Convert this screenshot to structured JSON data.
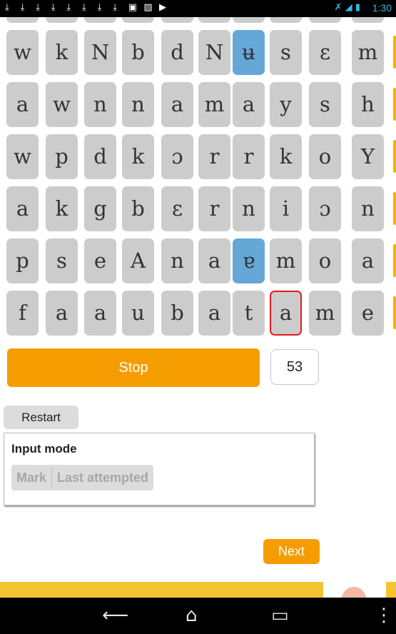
{
  "status_bar": {
    "time": "1:30",
    "notification_icons": [
      "download-icon",
      "download-icon",
      "download-icon",
      "download-icon",
      "download-icon",
      "download-icon",
      "download-icon",
      "download-icon",
      "sd-card-icon",
      "image-icon",
      "video-icon"
    ],
    "system_icons": [
      "mute-icon",
      "wifi-icon",
      "battery-icon"
    ]
  },
  "grid": {
    "rows": [
      [
        "w",
        "k",
        "N",
        "b",
        "d",
        "N",
        "ʉ",
        "s",
        "ɛ",
        "m"
      ],
      [
        "a",
        "w",
        "n",
        "n",
        "a",
        "m",
        "a",
        "y",
        "s",
        "h"
      ],
      [
        "w",
        "p",
        "d",
        "k",
        "ɔ",
        "r",
        "r",
        "k",
        "o",
        "Y"
      ],
      [
        "a",
        "k",
        "g",
        "b",
        "ɛ",
        "r",
        "n",
        "i",
        "ɔ",
        "n"
      ],
      [
        "p",
        "s",
        "e",
        "A",
        "n",
        "a",
        "ɐ",
        "m",
        "o",
        "a"
      ],
      [
        "f",
        "a",
        "a",
        "u",
        "b",
        "a",
        "t",
        "a",
        "m",
        "e"
      ]
    ],
    "marked_cells": [
      [
        0,
        6
      ],
      [
        4,
        6
      ]
    ],
    "current_cell": [
      5,
      7
    ]
  },
  "controls": {
    "stop_label": "Stop",
    "counter": "53",
    "restart_label": "Restart",
    "next_label": "Next"
  },
  "input_mode": {
    "title": "Input mode",
    "options": [
      "Mark",
      "Last attempted"
    ]
  },
  "colors": {
    "accent": "#f59d00",
    "marked": "#65a8d8",
    "current_border": "#e41b1b",
    "tile": "#cccccc",
    "footer": "#f4c430"
  },
  "nav_bar": {
    "icons": [
      "back-icon",
      "home-icon",
      "recents-icon",
      "menu-icon"
    ]
  }
}
